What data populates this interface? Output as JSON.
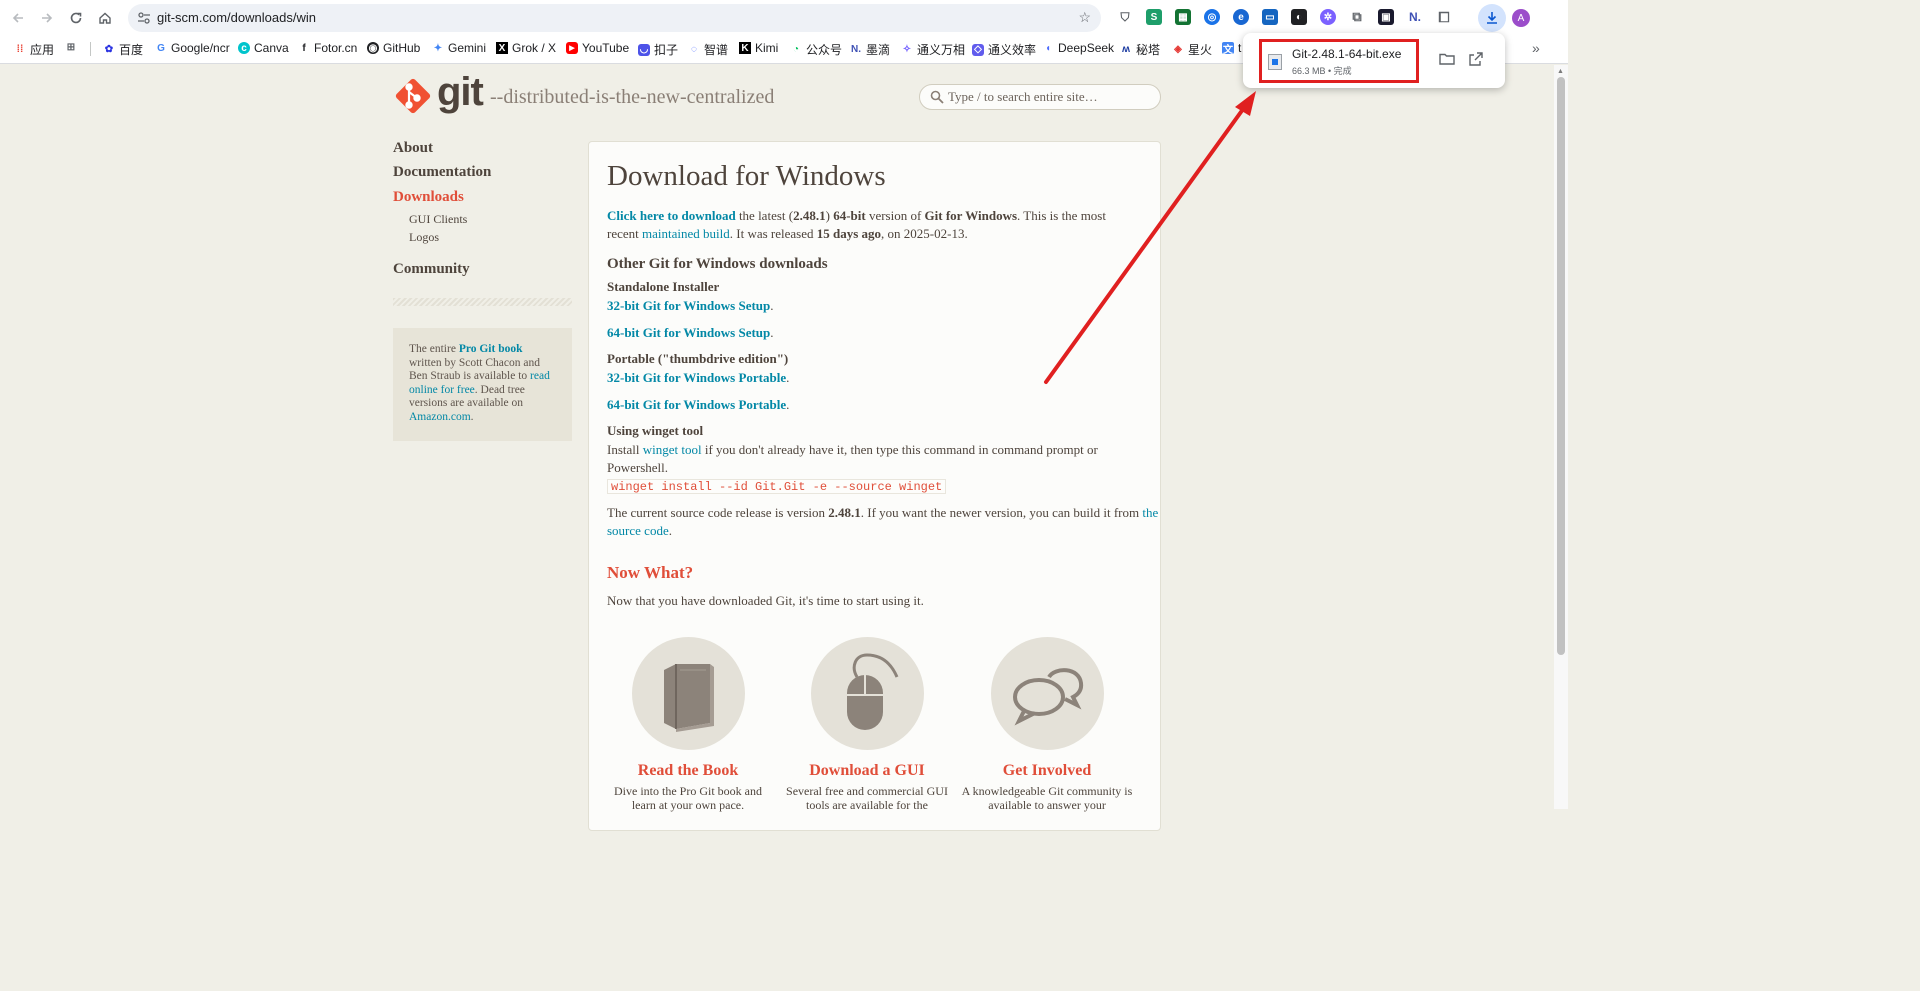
{
  "browser": {
    "url": "git-scm.com/downloads/win",
    "avatar_letter": "A",
    "bookmarks": [
      {
        "label": "应用",
        "icon": "apps-grid-icon"
      },
      {
        "label": "",
        "icon": "grid-icon"
      },
      {
        "label": "百度",
        "icon": "baidu-icon"
      },
      {
        "label": "Google/ncr",
        "icon": "google-icon"
      },
      {
        "label": "Canva",
        "icon": "canva-icon"
      },
      {
        "label": "Fotor.cn",
        "icon": "fotor-icon"
      },
      {
        "label": "GitHub",
        "icon": "github-icon"
      },
      {
        "label": "Gemini",
        "icon": "gemini-icon"
      },
      {
        "label": "Grok / X",
        "icon": "x-icon"
      },
      {
        "label": "YouTube",
        "icon": "youtube-icon"
      },
      {
        "label": "扣子",
        "icon": "coze-icon"
      },
      {
        "label": "智谱",
        "icon": "zhipu-icon"
      },
      {
        "label": "Kimi",
        "icon": "kimi-icon"
      },
      {
        "label": "公众号",
        "icon": "wechat-icon"
      },
      {
        "label": "墨滴",
        "icon": "modi-icon"
      },
      {
        "label": "通义万相",
        "icon": "tongyi-wanxiang-icon"
      },
      {
        "label": "通义效率",
        "icon": "tongyi-xiaolv-icon"
      },
      {
        "label": "DeepSeek",
        "icon": "deepseek-icon"
      },
      {
        "label": "秘塔",
        "icon": "metaso-icon"
      },
      {
        "label": "星火",
        "icon": "xinghuo-icon"
      },
      {
        "label": "t",
        "icon": "translate-icon"
      }
    ]
  },
  "download": {
    "filename": "Git-2.48.1-64-bit.exe",
    "status": "66.3 MB • 完成"
  },
  "site": {
    "logo_text": "git",
    "tagline": "--distributed-is-the-new-centralized",
    "search_placeholder": "Type / to search entire site…",
    "nav": {
      "about": "About",
      "documentation": "Documentation",
      "downloads": "Downloads",
      "gui_clients": "GUI Clients",
      "logos": "Logos",
      "community": "Community"
    },
    "book": {
      "t1": "The entire ",
      "link1": "Pro Git book",
      "t2": "written by Scott Chacon and",
      "t3": "Ben Straub is available to ",
      "link2a": "read",
      "link2b": "online for free",
      "t4": ". Dead tree",
      "t5": "versions are available on",
      "link3": "Amazon.com",
      "t6": "."
    }
  },
  "content": {
    "title": "Download for Windows",
    "intro": {
      "link_click": "Click here to download",
      "t1": " the latest (",
      "version": "2.48.1",
      "t2": ") ",
      "bits": "64-bit",
      "t3": " version of ",
      "product": "Git for Windows",
      "t4": ". This is the most",
      "t5": "recent ",
      "link_maintained": "maintained build",
      "t6": ". It was released ",
      "days": "15 days ago",
      "t7": ", on 2025-02-13."
    },
    "other_heading": "Other Git for Windows downloads",
    "standalone_heading": "Standalone Installer",
    "setup32": "32-bit Git for Windows Setup",
    "setup64": "64-bit Git for Windows Setup",
    "portable_heading": "Portable (\"thumbdrive edition\")",
    "portable32": "32-bit Git for Windows Portable",
    "portable64": "64-bit Git for Windows Portable",
    "period": ".",
    "winget_heading": "Using winget tool",
    "winget": {
      "t1": "Install ",
      "link": "winget tool",
      "t2": " if you don't already have it, then type this command in command prompt or",
      "t3": "Powershell."
    },
    "winget_cmd": "winget install --id Git.Git -e --source winget",
    "source": {
      "t1": "The current source code release is version ",
      "version": "2.48.1",
      "t2": ". If you want the newer version, you can build it from ",
      "link_a": "the",
      "link_b": "source code",
      "t3": "."
    },
    "now_what_heading": "Now What?",
    "now_what_text": "Now that you have downloaded Git, it's time to start using it.",
    "cards": [
      {
        "title": "Read the Book",
        "desc1": "Dive into the Pro Git book and",
        "desc2": "learn at your own pace."
      },
      {
        "title": "Download a GUI",
        "desc1": "Several free and commercial GUI",
        "desc2": "tools are available for the"
      },
      {
        "title": "Get Involved",
        "desc1": "A knowledgeable Git community is",
        "desc2": "available to answer your"
      }
    ]
  },
  "colors": {
    "accent": "#e04e39",
    "link": "#0388a6",
    "text": "#4e443c",
    "page_bg": "#f0efe7",
    "annotation": "#e02020"
  }
}
